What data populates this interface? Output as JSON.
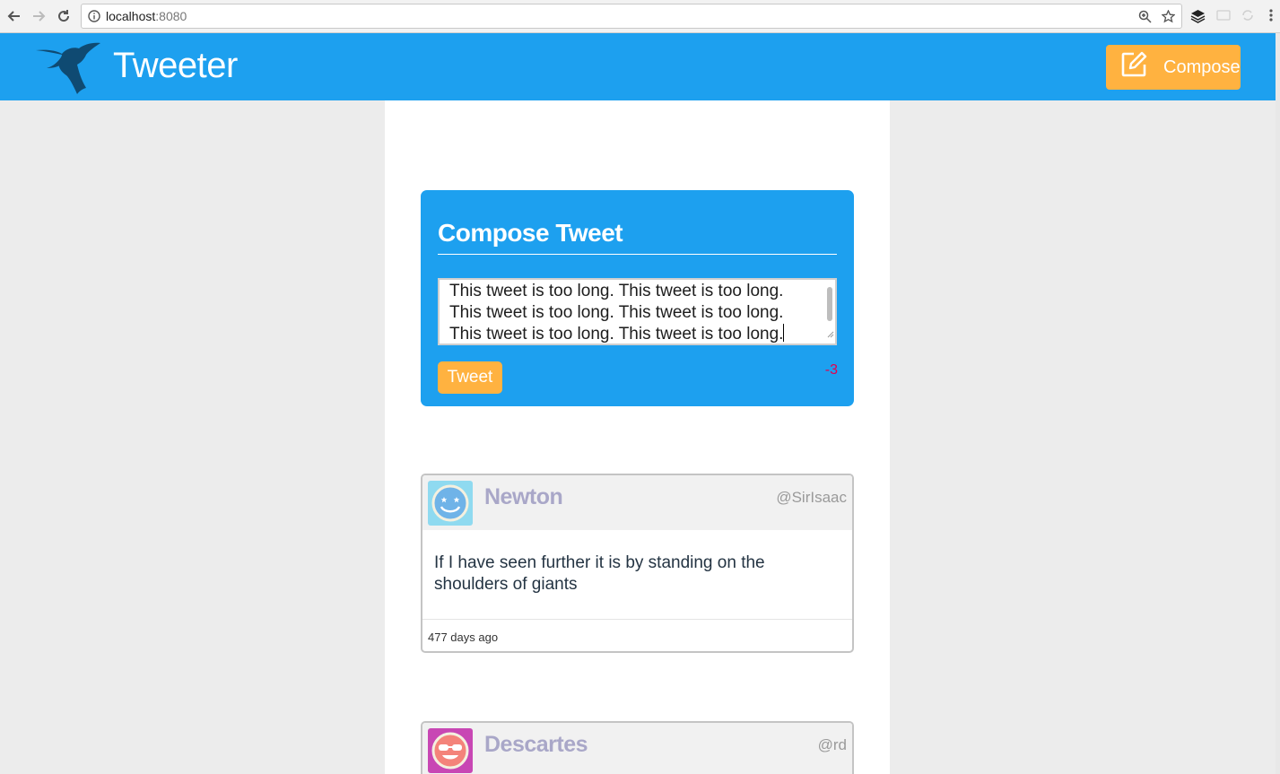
{
  "browser": {
    "url_host": "localhost",
    "url_port": ":8080"
  },
  "header": {
    "brand": "Tweeter",
    "compose_label": "Compose"
  },
  "compose": {
    "title": "Compose Tweet",
    "text": "This tweet is too long. This tweet is too long. This tweet is too long. This tweet is too long. This tweet is too long. This tweet is too long.",
    "tweet_label": "Tweet",
    "counter": "-3"
  },
  "tweets": [
    {
      "name": "Newton",
      "handle": "@SirIsaac",
      "content": "If I have seen further it is by standing on the shoulders of giants",
      "time": "477 days ago"
    },
    {
      "name": "Descartes",
      "handle": "@rd"
    }
  ],
  "colors": {
    "header": "#1da0ef",
    "accent": "#ffb240",
    "counter_error": "#e5004b",
    "name": "#a9a7c8"
  }
}
